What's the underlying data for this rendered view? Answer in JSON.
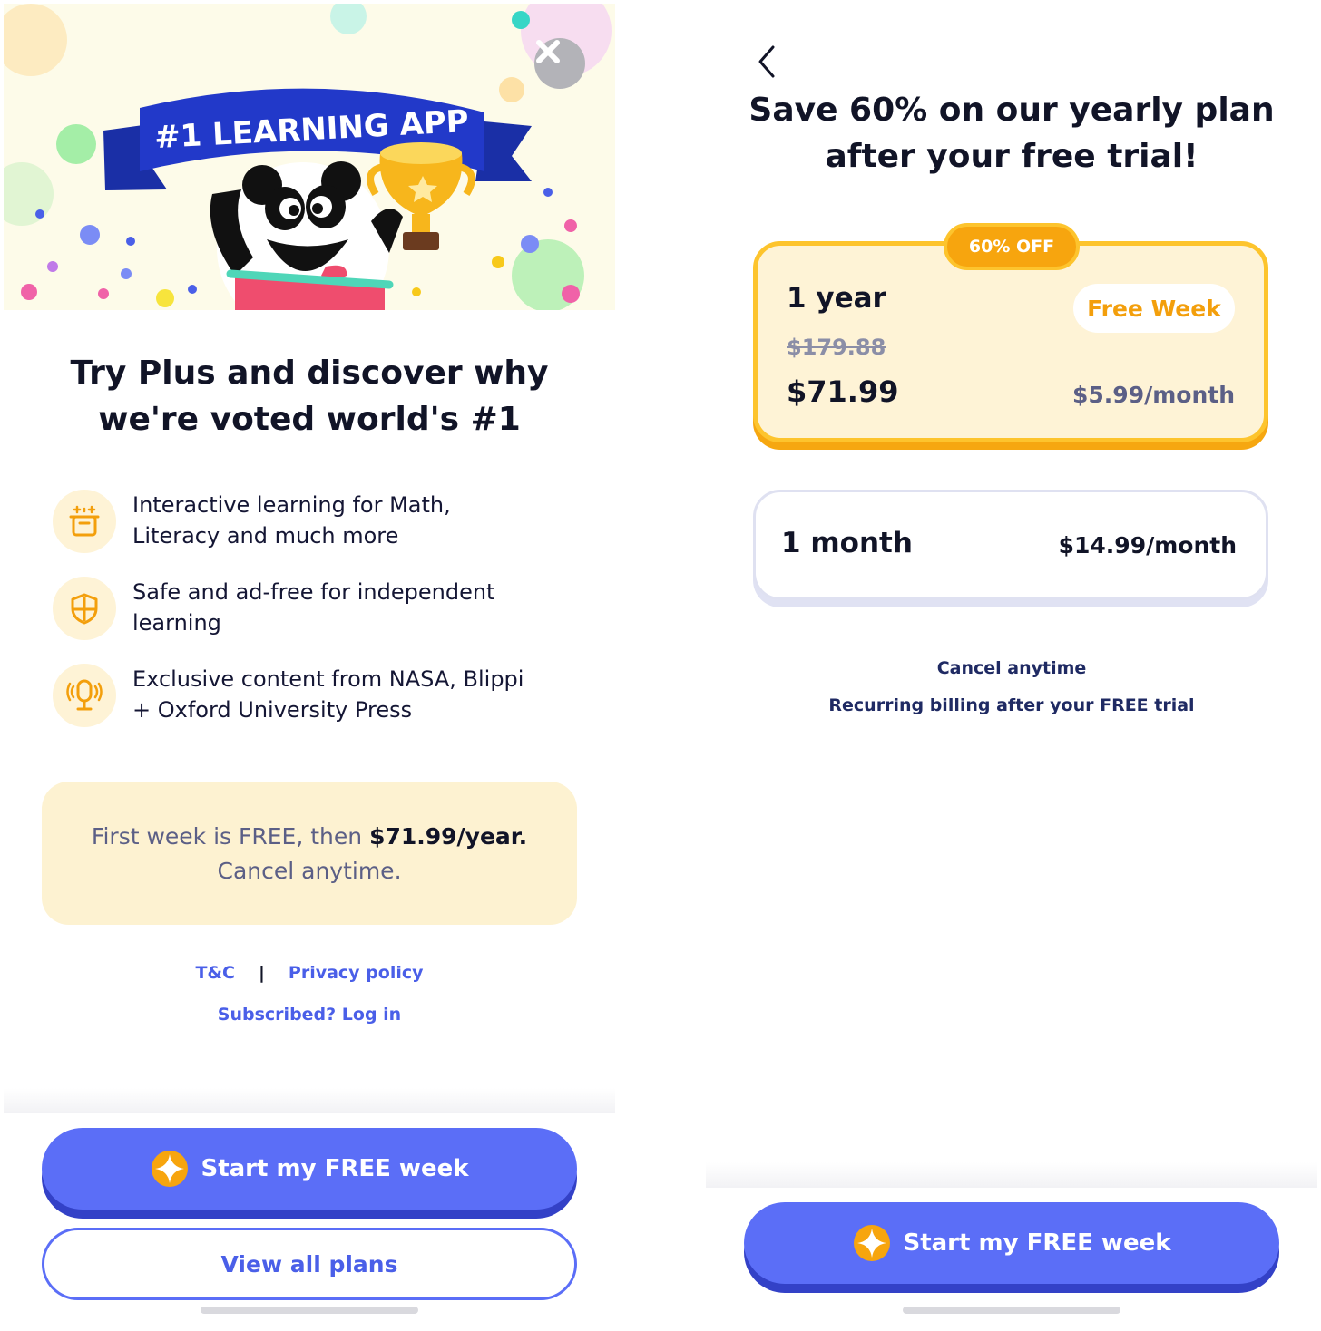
{
  "left": {
    "hero": {
      "ribbon_text": "#1 LEARNING APP"
    },
    "headline": {
      "line1": "Try Plus and discover why",
      "line2": "we're voted world's #1"
    },
    "features": [
      {
        "icon": "learning-blocks-icon",
        "line1": "Interactive learning for Math,",
        "line2": "Literacy and much more"
      },
      {
        "icon": "shield-icon",
        "line1": "Safe and ad-free for independent",
        "line2": "learning"
      },
      {
        "icon": "microphone-icon",
        "line1": "Exclusive content from NASA, Blippi",
        "line2": "+ Oxford University Press"
      }
    ],
    "promo": {
      "prefix": "First week is FREE, then ",
      "price": "$71.99/year.",
      "suffix": "Cancel anytime."
    },
    "links": {
      "terms": "T&C",
      "separator": "|",
      "privacy": "Privacy policy",
      "login": "Subscribed? Log in"
    },
    "cta_label": "Start my FREE week",
    "secondary_label": "View all plans"
  },
  "right": {
    "headline": {
      "line1": "Save 60% on our yearly plan",
      "line2": "after your free trial!"
    },
    "plans": [
      {
        "name": "1 year",
        "badge": "60% OFF",
        "pill": "Free Week",
        "old_price": "$179.88",
        "price": "$71.99",
        "per_month": "$5.99/month",
        "selected": true
      },
      {
        "name": "1 month",
        "per_month": "$14.99/month",
        "selected": false
      }
    ],
    "notes": {
      "cancel": "Cancel anytime",
      "billing": "Recurring billing after your FREE trial"
    },
    "cta_label": "Start my FREE week"
  },
  "colors": {
    "primary": "#5b6ef7",
    "primary_shadow": "#3341c7",
    "accent": "#fdc42d",
    "accent_dark": "#f7a50e",
    "cream": "#fef3d6",
    "text": "#111427",
    "link": "#4a5fe8"
  }
}
